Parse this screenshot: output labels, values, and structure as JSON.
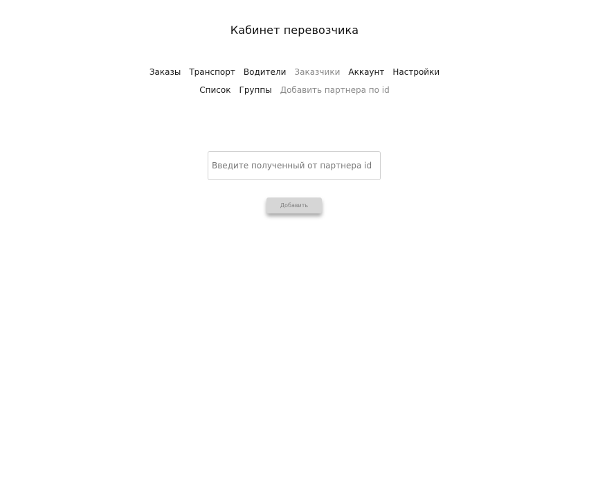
{
  "header": {
    "title": "Кабинет перевозчика"
  },
  "main_nav": {
    "items": [
      {
        "label": "Заказы"
      },
      {
        "label": "Транспорт"
      },
      {
        "label": "Водители"
      },
      {
        "label": "Заказчики"
      },
      {
        "label": "Аккаунт"
      },
      {
        "label": "Настройки"
      }
    ],
    "active_label": "Заказчики"
  },
  "sub_nav": {
    "items": [
      {
        "label": "Список"
      },
      {
        "label": "Группы"
      },
      {
        "label": "Добавить партнера по id"
      }
    ],
    "active_label": "Добавить партнера по id"
  },
  "form": {
    "partner_id": {
      "value": "",
      "placeholder": "Введите полученный от партнера id"
    },
    "add_label": "Добавить"
  },
  "colors": {
    "text": "#1a1a1a",
    "active_nav": "#8a8a8a",
    "button_bg": "#d6d6d6",
    "button_text": "#808080",
    "input_border": "#cfcfcf"
  }
}
